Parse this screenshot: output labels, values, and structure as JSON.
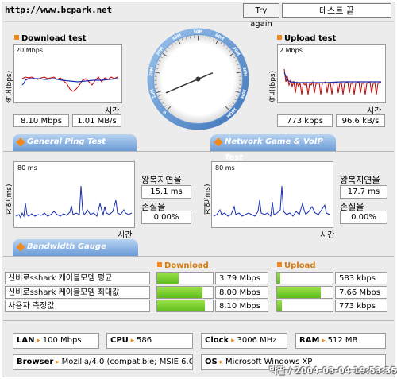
{
  "header": {
    "url": "http://www.bcpark.net",
    "try_again": "Try again",
    "status": "테스트 끝"
  },
  "download": {
    "title": "Download test",
    "axis_label": "속도(bps)",
    "max": "20 Mbps",
    "time_label": "시간",
    "speed_mbps": "8.10 Mbps",
    "speed_mbs": "1.01 MB/s"
  },
  "upload": {
    "title": "Upload test",
    "axis_label": "속도(bps)",
    "max": "2 Mbps",
    "time_label": "시간",
    "speed_kbps": "773 kbps",
    "speed_kbs": "96.6 kB/s"
  },
  "gauge": {
    "ticks": [
      "0",
      "10M",
      "20M",
      "30M",
      "40M",
      "50M",
      "60M",
      "70M",
      "80M",
      "90M",
      "100M"
    ],
    "needle_value_mbps": 8.1
  },
  "ping": {
    "title": "General Ping Test",
    "axis_label": "지연(ms)",
    "max": "80 ms",
    "rtt_label": "왕복지연율",
    "rtt": "15.1 ms",
    "loss_label": "손실율",
    "loss": "0.00%",
    "time_label": "시간"
  },
  "game": {
    "title": "Network Game & VoIP Test",
    "axis_label": "지연(ms)",
    "max": "80 ms",
    "rtt_label": "왕복지연율",
    "rtt": "17.7 ms",
    "loss_label": "손실율",
    "loss": "0.00%",
    "time_label": "시간"
  },
  "bandwidth": {
    "title": "Bandwidth Gauge",
    "download_header": "Download",
    "upload_header": "Upload",
    "rows": [
      {
        "label": "신비로sshark 케이블모뎀 평균",
        "down": "3.79 Mbps",
        "down_fraction": 0.38,
        "up": "583 kbps",
        "up_fraction": 0.06
      },
      {
        "label": "신비로sshark 케이블모뎀 최대값",
        "down": "8.00 Mbps",
        "down_fraction": 0.82,
        "up": "7.66 Mbps",
        "up_fraction": 0.78
      },
      {
        "label": "사용자 측정값",
        "down": "8.10 Mbps",
        "down_fraction": 0.85,
        "up": "773 kbps",
        "up_fraction": 0.08
      }
    ]
  },
  "info": {
    "lan_label": "LAN",
    "lan": "100 Mbps",
    "cpu_label": "CPU",
    "cpu": "586",
    "clock_label": "Clock",
    "clock": "3006 MHz",
    "ram_label": "RAM",
    "ram": "512 MB",
    "browser_label": "Browser",
    "browser": "Mozilla/4.0 (compatible; MSIE 6.0",
    "os_label": "OS",
    "os": "Microsoft Windows XP"
  },
  "watermark": "막팔 / 2004-03-04 19:53:35",
  "colors": {
    "accent": "#f0881e",
    "bar_blue": "#6b9bd8",
    "line_red": "#cc0000",
    "line_blue": "#1a2fb0",
    "green": "#6cc825"
  }
}
